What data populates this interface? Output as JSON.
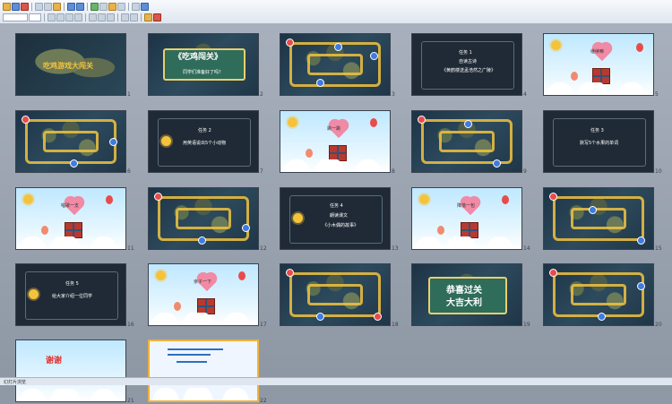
{
  "status": {
    "left": "幻灯片浏览",
    "theme": "",
    "zoom": ""
  },
  "slides": [
    {
      "n": "1",
      "title": "吃鸡游戏大闯关"
    },
    {
      "n": "2",
      "title": "《吃鸡闯关》",
      "sub": "同学们准备好了吗？"
    },
    {
      "n": "3"
    },
    {
      "n": "4",
      "task": "任务 1",
      "line1": "自读古诗",
      "line2": "《黄鹤楼送孟浩然之广陵》"
    },
    {
      "n": "5",
      "label": "继续嘛"
    },
    {
      "n": "6"
    },
    {
      "n": "7",
      "task": "任务 2",
      "line1": "用英语说出5个小动物"
    },
    {
      "n": "8",
      "label": "跳一跳"
    },
    {
      "n": "9"
    },
    {
      "n": "10",
      "task": "任务 3",
      "line1": "默写5个水果的单词"
    },
    {
      "n": "11",
      "label": "唱歌一支"
    },
    {
      "n": "12"
    },
    {
      "n": "13",
      "task": "任务 4",
      "line1": "朗读课文",
      "line2": "《小木偶的故事》"
    },
    {
      "n": "14",
      "label": "降落一包"
    },
    {
      "n": "15"
    },
    {
      "n": "16",
      "task": "任务 5",
      "line1": "给大家介绍一位同学"
    },
    {
      "n": "17",
      "label": "亲子一下"
    },
    {
      "n": "18"
    },
    {
      "n": "19",
      "line1": "恭喜过关",
      "line2": "大吉大利"
    },
    {
      "n": "20"
    },
    {
      "n": "21",
      "title": "谢谢"
    },
    {
      "n": "22"
    }
  ]
}
